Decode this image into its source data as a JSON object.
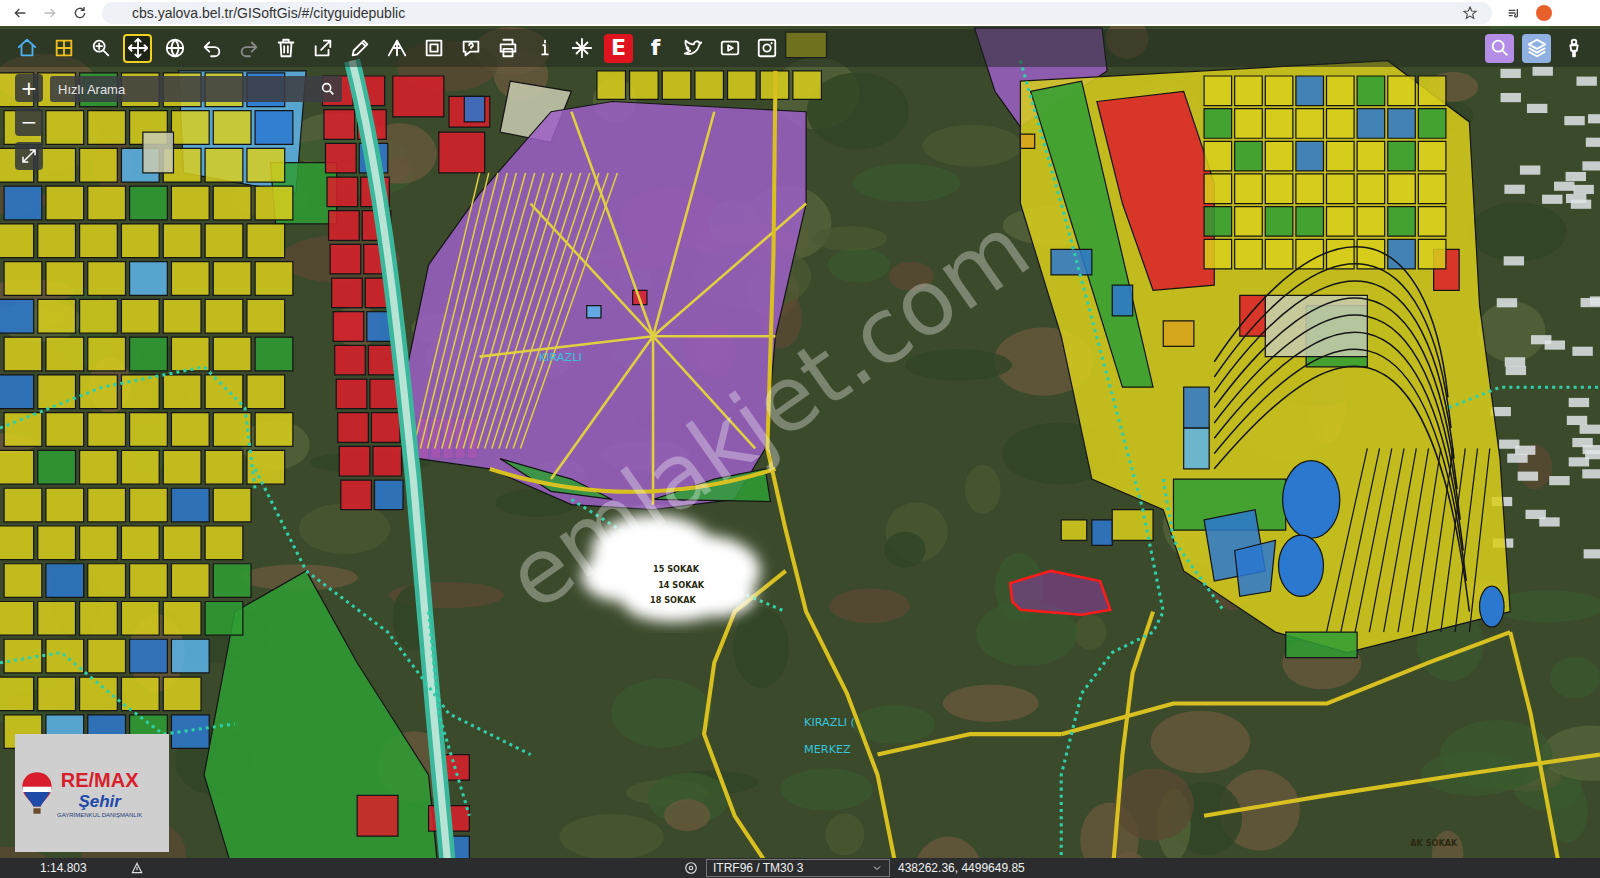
{
  "browser": {
    "url": "cbs.yalova.bel.tr/GISoftGis/#/cityguidepublic"
  },
  "toolbar": {
    "tools": [
      {
        "selected": false,
        "disabled": false,
        "color": "#4db0f0"
      },
      {
        "selected": false,
        "disabled": false,
        "color": "#f0c020"
      },
      {
        "selected": false,
        "disabled": false,
        "color": "#ffffff"
      },
      {
        "selected": true,
        "disabled": false,
        "color": "#ffffff"
      },
      {
        "selected": false,
        "disabled": false,
        "color": "#ffffff"
      },
      {
        "selected": false,
        "disabled": false,
        "color": "#ffffff"
      },
      {
        "selected": false,
        "disabled": true,
        "color": "#8a8a8a"
      },
      {
        "selected": false,
        "disabled": false,
        "color": "#ffffff"
      },
      {
        "selected": false,
        "disabled": false,
        "color": "#ffffff"
      },
      {
        "selected": false,
        "disabled": false,
        "color": "#ffffff"
      },
      {
        "selected": false,
        "disabled": false,
        "color": "#ffffff"
      },
      {
        "selected": false,
        "disabled": false,
        "color": "#ffffff"
      },
      {
        "selected": false,
        "disabled": false,
        "color": "#ffffff"
      },
      {
        "selected": false,
        "disabled": false,
        "color": "#ffffff"
      },
      {
        "selected": false,
        "disabled": false,
        "color": "#ffffff"
      },
      {
        "selected": false,
        "disabled": false,
        "color": "#ffffff"
      },
      {
        "selected": false,
        "disabled": false,
        "label": "E",
        "color": "#ffffff",
        "background": "#e0141e"
      },
      {
        "selected": false,
        "disabled": false,
        "label": "f",
        "color": "#ffffff",
        "background": "transparent"
      },
      {
        "selected": false,
        "disabled": false,
        "color": "#ffffff"
      },
      {
        "selected": false,
        "disabled": false,
        "color": "#ffffff"
      },
      {
        "selected": false,
        "disabled": false,
        "color": "#ffffff"
      }
    ],
    "right_tools": [
      {
        "color": "#b48ee6"
      },
      {
        "color": "#8fb0e0"
      },
      {
        "color": "transparent"
      }
    ]
  },
  "search": {
    "placeholder": "Hızlı Arama"
  },
  "zoom_controls": [
    "+",
    "−"
  ],
  "zones": [
    {
      "kind": "residential",
      "color": "#d9cf1c"
    },
    {
      "kind": "commercial",
      "color": "#dc1e2c"
    },
    {
      "kind": "industrial",
      "color": "#9c5fc7"
    },
    {
      "kind": "public",
      "color": "#2b78d0"
    },
    {
      "kind": "green",
      "color": "#2e9d34"
    },
    {
      "kind": "education",
      "color": "#5cb4ec"
    },
    {
      "kind": "other",
      "color": "#c9cbb0"
    },
    {
      "kind": "special",
      "color": "#d9a21c"
    }
  ],
  "map": {
    "labels": [
      {
        "text": "KIRAZLI",
        "kind": "district"
      },
      {
        "text": "KIRAZLI (",
        "kind": "district"
      },
      {
        "text": "MERKEZ",
        "kind": "district"
      },
      {
        "text": "15 SOKAK",
        "kind": "street"
      },
      {
        "text": "14 SOKAK",
        "kind": "street"
      },
      {
        "text": "18 SOKAK",
        "kind": "street"
      },
      {
        "text": "AK SOKAK",
        "kind": "street"
      }
    ],
    "watermark": "emlakjet.com",
    "selected_parcel": {
      "selected": true,
      "color": "#ff1a1a"
    }
  },
  "logo": {
    "brand": "RE/MAX",
    "office": "Şehir",
    "tagline": "GAYRİMENKUL DANIŞMANLIK"
  },
  "status_bar": {
    "scale": "1:14.803",
    "projection": "ITRF96 / TM30 3",
    "coordinates": "438262.36, 4499649.85"
  }
}
